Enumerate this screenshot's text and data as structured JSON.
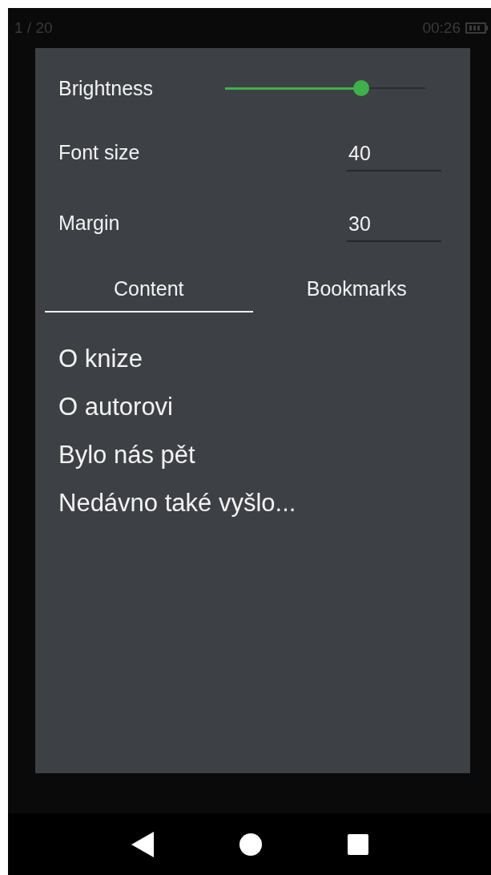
{
  "status_bar": {
    "page": "1 / 20",
    "time": "00:26"
  },
  "settings": {
    "brightness": {
      "label": "Brightness",
      "level": 0.68
    },
    "fields": [
      {
        "label": "Font size",
        "value": "40"
      },
      {
        "label": "Margin",
        "value": "30"
      }
    ]
  },
  "tabs": [
    {
      "label": "Content",
      "selected": true
    },
    {
      "label": "Bookmarks",
      "selected": false
    }
  ],
  "contents": [
    "O knize",
    "O autorovi",
    "Bylo nás pět",
    "Nedávno také vyšlo..."
  ]
}
